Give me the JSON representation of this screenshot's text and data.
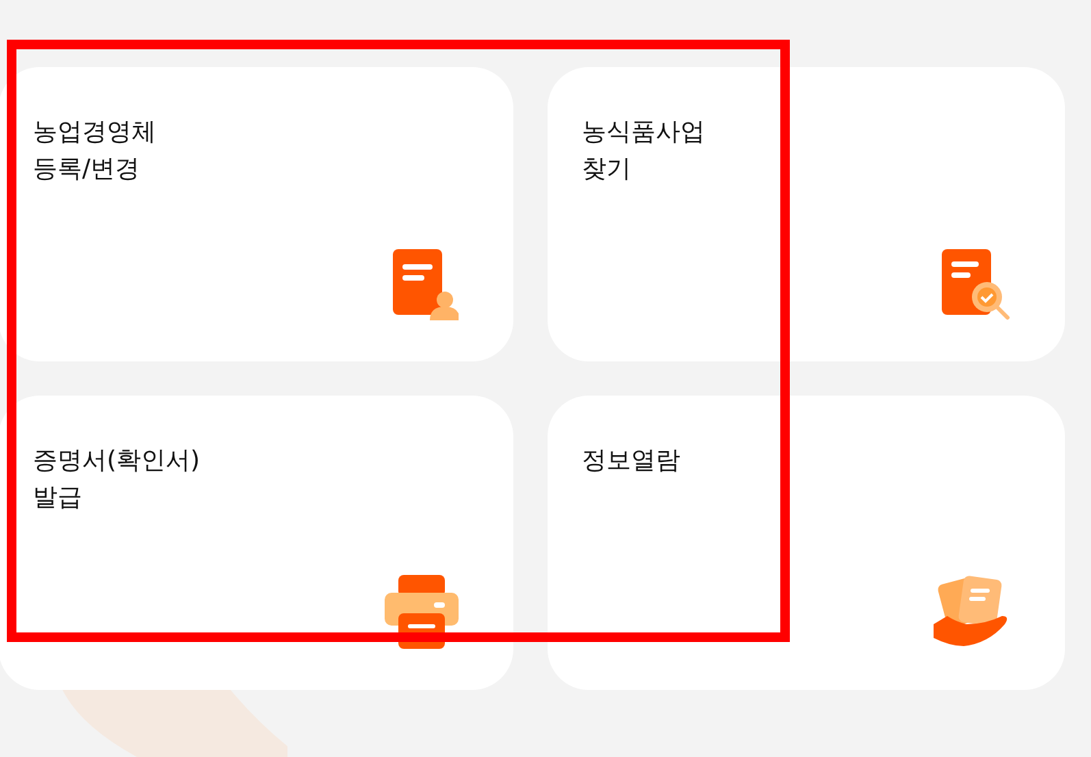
{
  "menu_cards": [
    {
      "title": "농업경영체\n등록/변경",
      "kind": "document-person"
    },
    {
      "title": "농식품사업\n찾기",
      "kind": "document-search"
    },
    {
      "title": "증명서(확인서)\n발급",
      "kind": "printer"
    },
    {
      "title": "정보열람",
      "kind": "hand-documents"
    }
  ]
}
